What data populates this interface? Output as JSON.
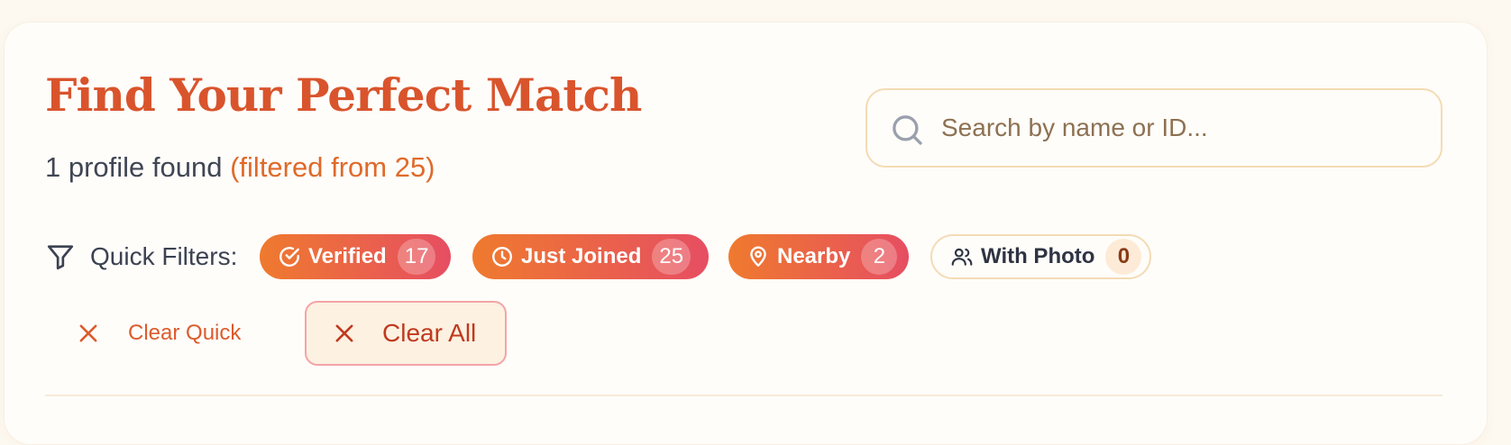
{
  "header": {
    "title": "Find Your Perfect Match",
    "results_count": "1 profile found",
    "filtered_note": "(filtered from 25)"
  },
  "search": {
    "placeholder": "Search by name or ID...",
    "value": "",
    "icon": "search-icon"
  },
  "quick_filters": {
    "label": "Quick Filters:",
    "icon": "funnel-icon",
    "chips": [
      {
        "label": "Verified",
        "count": "17",
        "icon": "check-circle-icon",
        "active": true
      },
      {
        "label": "Just Joined",
        "count": "25",
        "icon": "clock-icon",
        "active": true
      },
      {
        "label": "Nearby",
        "count": "2",
        "icon": "map-pin-icon",
        "active": true
      },
      {
        "label": "With Photo",
        "count": "0",
        "icon": "users-icon",
        "active": false
      }
    ]
  },
  "actions": {
    "clear_quick": "Clear Quick",
    "clear_all": "Clear All"
  },
  "colors": {
    "title": "#d9542c",
    "accent_orange": "#ef7a2e",
    "accent_rose": "#e64e62",
    "border_sand": "#f4dbb4",
    "background": "#fdf8f0"
  }
}
